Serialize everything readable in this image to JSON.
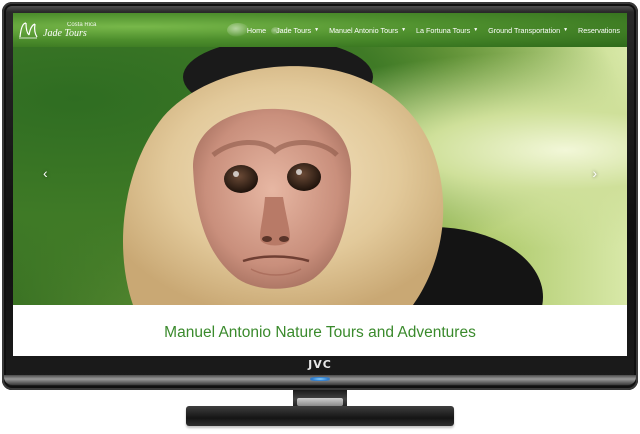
{
  "brand": {
    "small": "Costa Rica",
    "name": "Jade Tours"
  },
  "nav": {
    "items": [
      {
        "label": "Home",
        "dropdown": false
      },
      {
        "label": "Jade Tours",
        "dropdown": true
      },
      {
        "label": "Manuel Antonio Tours",
        "dropdown": true
      },
      {
        "label": "La Fortuna Tours",
        "dropdown": true
      },
      {
        "label": "Ground Transportation",
        "dropdown": true
      },
      {
        "label": "Reservations",
        "dropdown": false
      }
    ]
  },
  "hero": {
    "prev_icon": "chevron-left-icon",
    "next_icon": "chevron-right-icon",
    "prev_glyph": "‹",
    "next_glyph": "›"
  },
  "page": {
    "title": "Manuel Antonio Nature Tours and Adventures"
  },
  "tv": {
    "logo": "JVC"
  },
  "colors": {
    "nav_green": "#4e8f2d",
    "title_green": "#3a8a2c"
  }
}
